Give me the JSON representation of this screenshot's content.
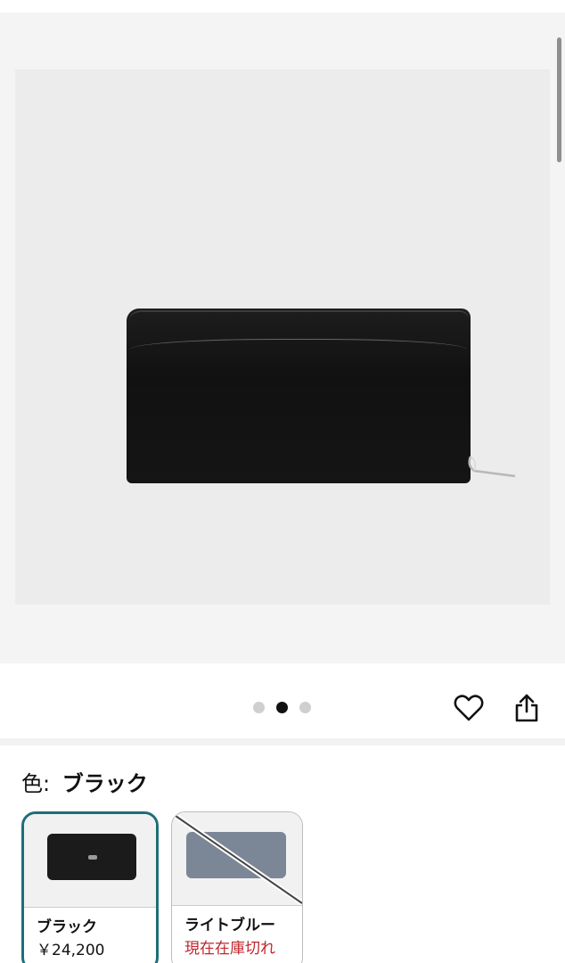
{
  "gallery": {
    "image_alt": "Black zip-around wallet",
    "dots": [
      {
        "active": false
      },
      {
        "active": true
      },
      {
        "active": false
      }
    ]
  },
  "actions": {
    "favorite_icon": "heart-icon",
    "share_icon": "share-icon"
  },
  "color": {
    "label": "色:",
    "selected": "ブラック"
  },
  "swatches": [
    {
      "name": "ブラック",
      "price": "￥24,200",
      "selected": true,
      "available": true,
      "thumb_color": "#1b1b1b"
    },
    {
      "name": "ライトブルー",
      "price": "現在在庫切れ",
      "selected": false,
      "available": false,
      "thumb_color": "#7b8796"
    }
  ],
  "colors": {
    "selected_border": "#1e6e78",
    "out_of_stock_text": "#c0262d"
  }
}
